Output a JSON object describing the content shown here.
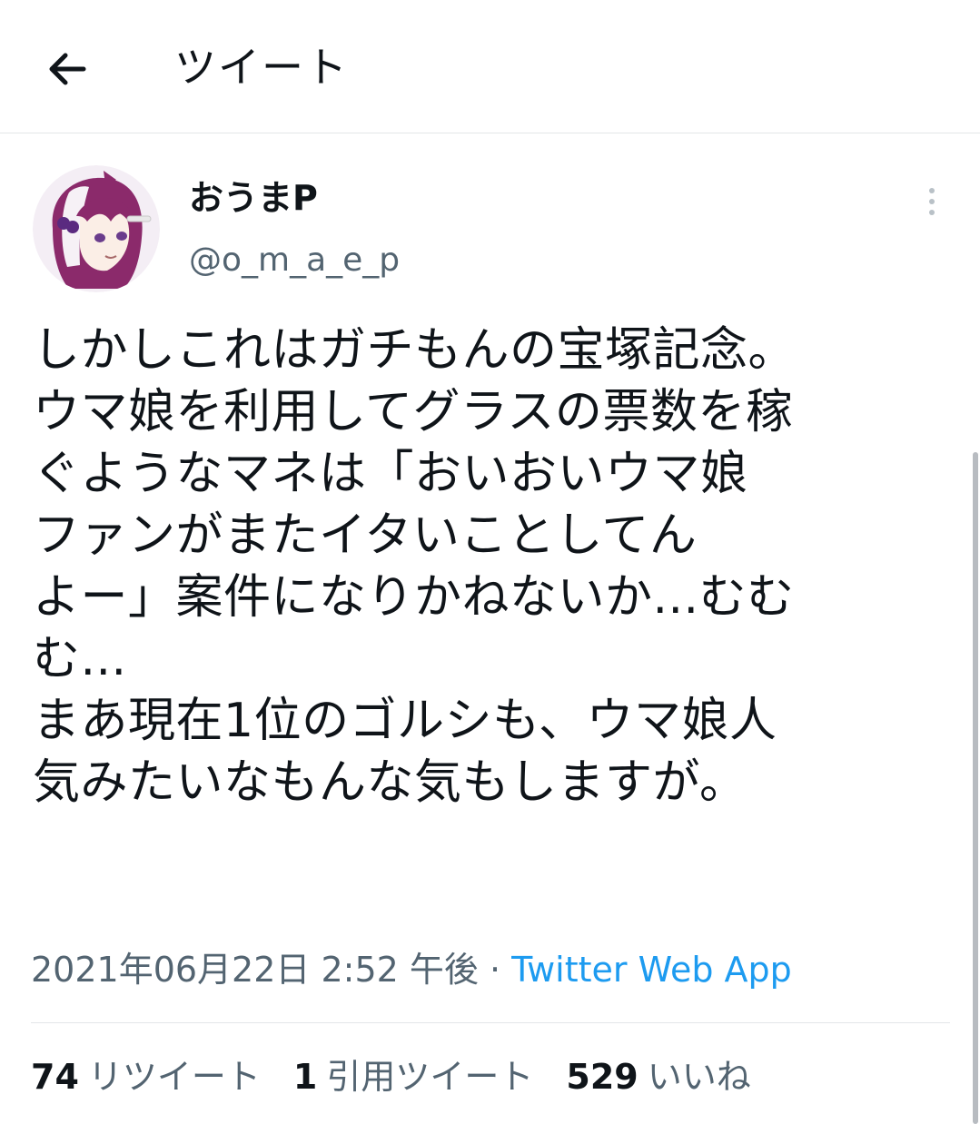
{
  "header": {
    "title": "ツイート",
    "back_icon": "arrow-left-icon"
  },
  "tweet": {
    "display_name": "おうまP",
    "handle": "@o_m_a_e_p",
    "lines": [
      "しかしこれはガチもんの宝塚記念。",
      "ウマ娘を利用してグラスの票数を稼",
      "ぐようなマネは「おいおいウマ娘",
      "ファンがまたイタいことしてん",
      "よー」案件になりかねないか...むむ",
      "む...",
      "まあ現在1位のゴルシも、ウマ娘人",
      "気みたいなもんな気もしますが。"
    ],
    "timestamp": "2021年06月22日 2:52 午後",
    "separator": " · ",
    "source": "Twitter Web App"
  },
  "stats": {
    "retweets_count": "74",
    "retweets_label": "リツイート",
    "quotes_count": "1",
    "quotes_label": "引用ツイート",
    "likes_count": "529",
    "likes_label": "いいね"
  },
  "colors": {
    "text": "#0f1419",
    "secondary": "#536471",
    "link": "#1d9bf0",
    "border": "#e3e6e8",
    "avatar_hair": "#8b2a6b"
  }
}
